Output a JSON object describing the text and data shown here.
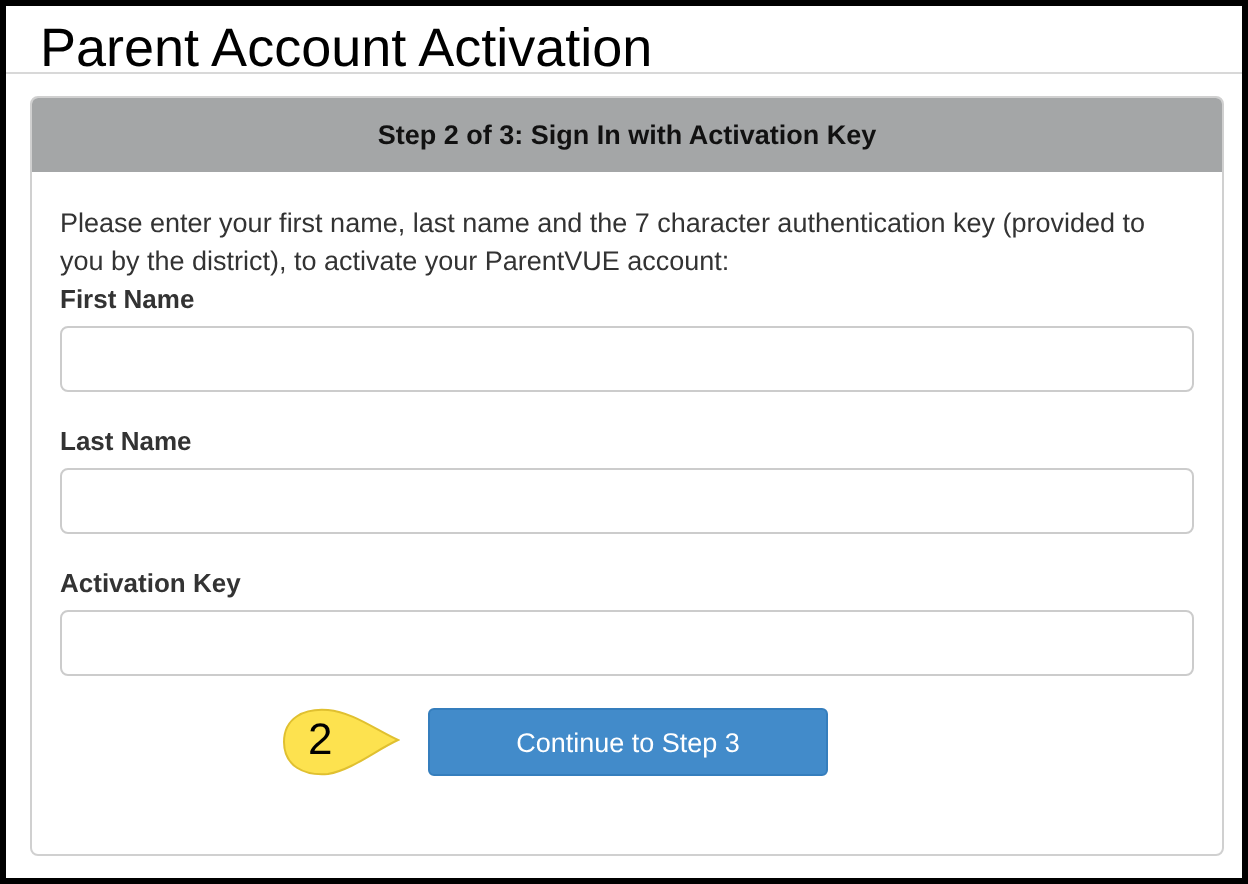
{
  "page": {
    "title": "Parent Account Activation"
  },
  "panel": {
    "heading": "Step 2 of 3: Sign In with Activation Key",
    "instructions": "Please enter your first name, last name and the 7 character authentication key (provided to you by the district), to activate your ParentVUE account:",
    "fields": [
      {
        "label": "First Name"
      },
      {
        "label": "Last Name"
      },
      {
        "label": "Activation Key"
      }
    ],
    "button": "Continue to Step 3"
  },
  "callout": {
    "label": "2"
  }
}
